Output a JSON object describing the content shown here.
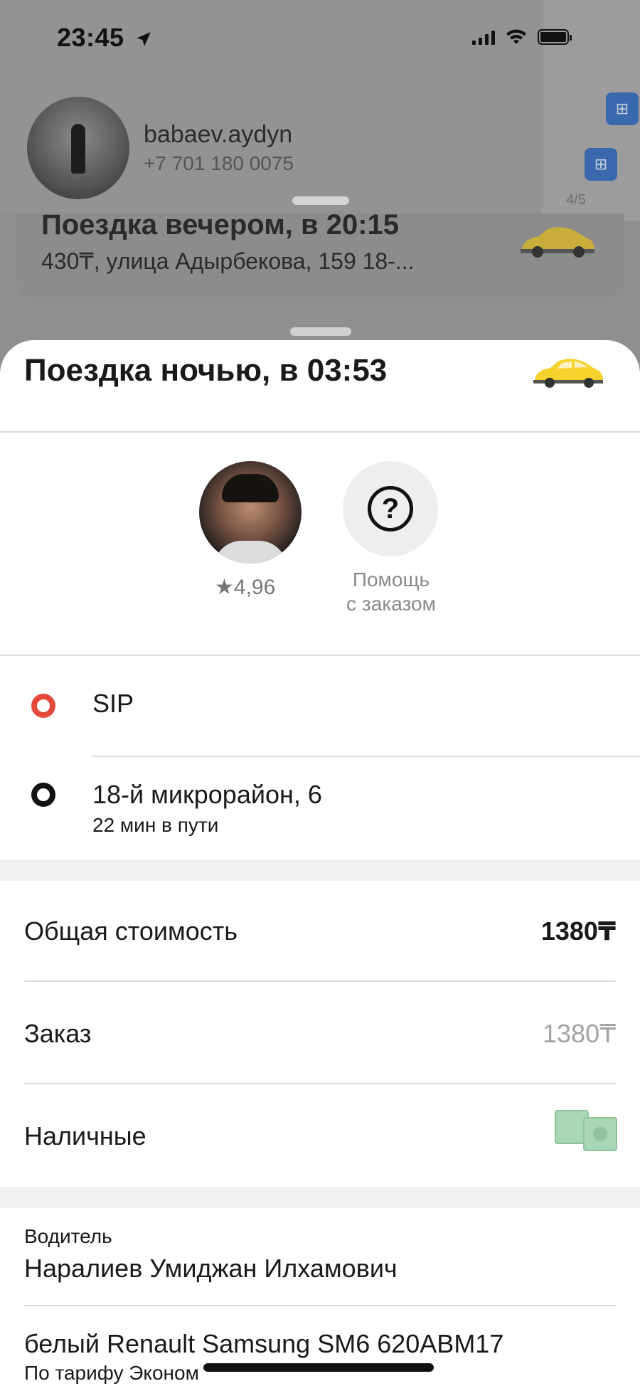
{
  "status_bar": {
    "time": "23:45",
    "icons": [
      "location-arrow-icon",
      "cellular-icon",
      "wifi-icon",
      "battery-icon"
    ]
  },
  "account": {
    "username": "babaev.aydyn",
    "phone": "+7 701 180 0075"
  },
  "map": {
    "counter": "4/5"
  },
  "previous_trip": {
    "title": "Поездка вечером, в 20:15",
    "subtitle": "430₸, улица Адырбекова, 159 18-..."
  },
  "trip": {
    "title": "Поездка ночью, в 03:53",
    "driver_rating": "★4,96",
    "help_label_line1": "Помощь",
    "help_label_line2": "с заказом",
    "route": {
      "from": "SIP",
      "to": "18-й микрорайон, 6",
      "eta": "22 мин в пути"
    },
    "cost": {
      "total_label": "Общая стоимость",
      "total_value": "1380₸",
      "order_label": "Заказ",
      "order_value": "1380₸",
      "payment_label": "Наличные"
    },
    "driver": {
      "caption": "Водитель",
      "name": "Наралиев Умиджан Илхамович",
      "car": "белый Renault Samsung SM6 620ABM17",
      "tariff": "По тарифу Эконом"
    }
  },
  "colors": {
    "origin_dot": "#e44a3b",
    "destination_dot": "#111111",
    "taxi_yellow": "#f6d22c",
    "cash_green": "#a9d6b4"
  }
}
